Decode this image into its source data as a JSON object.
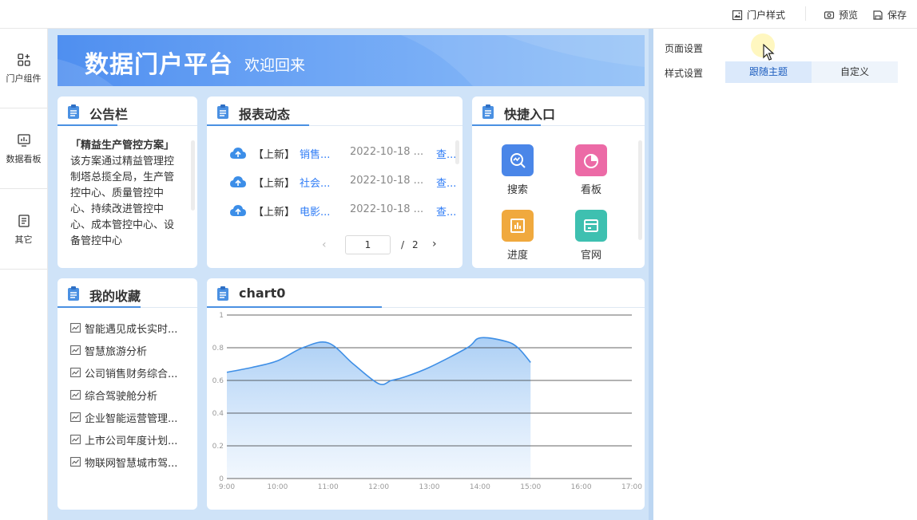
{
  "toolbar": {
    "portal_style": "门户样式",
    "preview": "预览",
    "save": "保存"
  },
  "sidebar": {
    "items": [
      {
        "label": "门户组件",
        "icon": "grid-plus-icon"
      },
      {
        "label": "数据看板",
        "icon": "bar-chart-icon"
      },
      {
        "label": "其它",
        "icon": "document-icon"
      }
    ]
  },
  "banner": {
    "title": "数据门户平台",
    "subtitle": "欢迎回来"
  },
  "notice": {
    "title": "公告栏",
    "heading": "「精益生产管控方案」",
    "text": "该方案通过精益管理控制塔总揽全局，生产管控中心、质量管控中心、持续改进管控中心、成本管控中心、设备管控中心"
  },
  "reports": {
    "title": "报表动态",
    "items": [
      {
        "tag": "【上新】",
        "name": "销售...",
        "date": "2022-10-18 ...",
        "link": "查..."
      },
      {
        "tag": "【上新】",
        "name": "社会...",
        "date": "2022-10-18 ...",
        "link": "查..."
      },
      {
        "tag": "【上新】",
        "name": "电影...",
        "date": "2022-10-18 ...",
        "link": "查..."
      }
    ],
    "page": "1",
    "page_separator": "/",
    "total_pages": "2"
  },
  "quick": {
    "title": "快捷入口",
    "items": [
      {
        "label": "搜索",
        "icon": "search-chart-icon",
        "color": "#4a86e8"
      },
      {
        "label": "看板",
        "icon": "pie-chart-icon",
        "color": "#ec6aa6"
      },
      {
        "label": "进度",
        "icon": "progress-bars-icon",
        "color": "#f0a93e"
      },
      {
        "label": "官网",
        "icon": "window-icon",
        "color": "#3ec0b0"
      }
    ]
  },
  "favorites": {
    "title": "我的收藏",
    "items": [
      "智能遇见成长实时...",
      "智慧旅游分析",
      "公司销售财务综合...",
      "综合驾驶舱分析",
      "企业智能运营管理...",
      "上市公司年度计划...",
      "物联网智慧城市驾..."
    ]
  },
  "chart": {
    "title": "chart0"
  },
  "chart_data": {
    "type": "area",
    "x": [
      "9:00",
      "10:00",
      "11:00",
      "12:00",
      "13:00",
      "14:00",
      "15:00",
      "16:00",
      "17:00"
    ],
    "values": [
      0.65,
      0.68,
      0.72,
      0.8,
      0.83,
      0.7,
      0.58,
      0.6,
      0.62,
      0.68,
      0.8,
      0.86,
      0.84,
      0.8,
      0.71
    ],
    "value_x": [
      0,
      0.5,
      1,
      1.5,
      2,
      2.5,
      3,
      3.25,
      3.5,
      4,
      4.75,
      5,
      5.5,
      5.75,
      6
    ],
    "yticks": [
      "0",
      "0.2",
      "0.4",
      "0.6",
      "0.8",
      "1"
    ],
    "ylim": [
      0,
      1
    ],
    "grid": true,
    "color": "#3f8fe6"
  },
  "settings": {
    "page_settings": "页面设置",
    "style_settings": "样式设置",
    "follow_theme": "跟随主题",
    "custom": "自定义"
  },
  "colors": {
    "accent": "#4a90e2",
    "canvas_bg": "#cfe3f8",
    "link": "#2f7cf6"
  }
}
